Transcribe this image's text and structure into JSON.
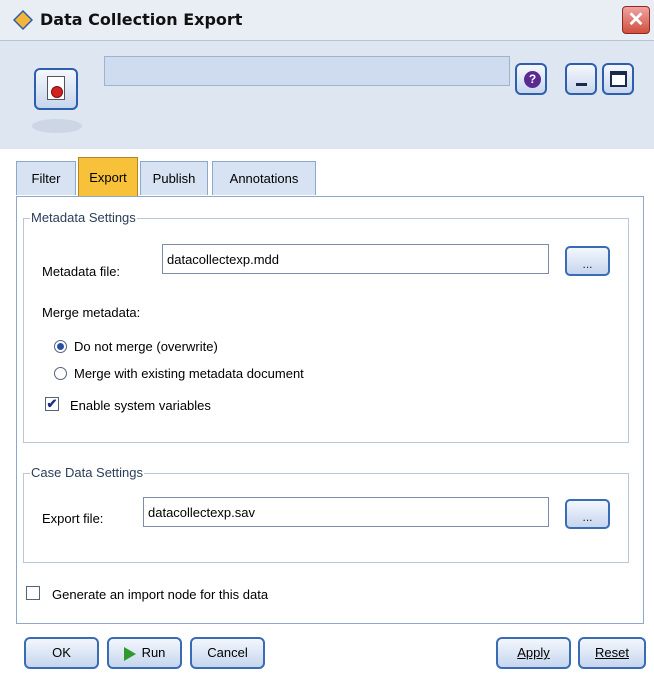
{
  "window": {
    "title": "Data Collection Export",
    "close_glyph": "✕",
    "icon": "diamond-node-icon"
  },
  "toolbar": {
    "node_name": "",
    "help_glyph": "?",
    "node_icon": "document-node-icon"
  },
  "tabs": [
    {
      "label": "Filter",
      "active": false
    },
    {
      "label": "Export",
      "active": true
    },
    {
      "label": "Publish",
      "active": false
    },
    {
      "label": "Annotations",
      "active": false
    }
  ],
  "metadata": {
    "group_title": "Metadata Settings",
    "file_label": "Metadata file:",
    "file_value": "datacollectexp.mdd",
    "browse_label": "...",
    "merge_label": "Merge metadata:",
    "options": [
      {
        "label": "Do not merge (overwrite)",
        "checked": true
      },
      {
        "label": "Merge with existing metadata document",
        "checked": false
      }
    ],
    "system_vars_label": "Enable system variables",
    "system_vars_checked": true
  },
  "casedata": {
    "group_title": "Case Data Settings",
    "file_label": "Export file:",
    "file_value": "datacollectexp.sav",
    "browse_label": "..."
  },
  "generate_import": {
    "label": "Generate an import node for this data",
    "checked": false
  },
  "buttons": {
    "ok": "OK",
    "run": "Run",
    "cancel": "Cancel",
    "apply": "Apply",
    "reset": "Reset"
  },
  "colors": {
    "active_tab": "#f7c23a",
    "accent_border": "#3a6bb5"
  }
}
